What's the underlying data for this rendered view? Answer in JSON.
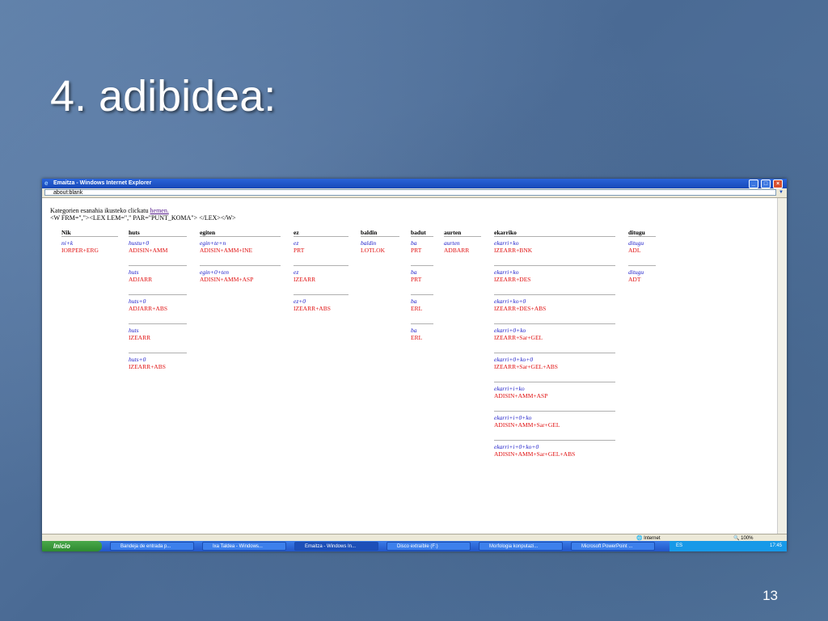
{
  "slide": {
    "title": "4. adibidea:",
    "page_number": "13"
  },
  "window": {
    "title": "Emaitza - Windows Internet Explorer",
    "address": "about:blank",
    "minimize": "_",
    "maximize": "□",
    "close": "×"
  },
  "content": {
    "intro_prefix": "Kategorien esanahia ikusteko clickatu ",
    "intro_link": "hemen.",
    "intro_line2": "<W FRM=\",\"><LEX LEM=\",\" PAR=\"PUNT_KOMA\"> </LEX></W>",
    "columns": [
      {
        "header": "Nik",
        "entries": [
          {
            "lemma": "ni+k",
            "cat": "IORPER+ERG"
          }
        ]
      },
      {
        "header": "huts",
        "entries": [
          {
            "lemma": "hustu+0",
            "cat": "ADISIN+AMM"
          },
          {
            "lemma": "huts",
            "cat": "ADJARR"
          },
          {
            "lemma": "huts+0",
            "cat": "ADJARR+ABS"
          },
          {
            "lemma": "huts",
            "cat": "IZEARR"
          },
          {
            "lemma": "huts+0",
            "cat": "IZEARR+ABS"
          }
        ]
      },
      {
        "header": "egiten",
        "entries": [
          {
            "lemma": "egin+te+n",
            "cat": "ADISIN+AMM+INE"
          },
          {
            "lemma": "egin+0+ten",
            "cat": "ADISIN+AMM+ASP"
          }
        ]
      },
      {
        "header": "ez",
        "entries": [
          {
            "lemma": "ez",
            "cat": "PRT"
          },
          {
            "lemma": "ez",
            "cat": "IZEARR"
          },
          {
            "lemma": "ez+0",
            "cat": "IZEARR+ABS"
          }
        ]
      },
      {
        "header": "baldin",
        "entries": [
          {
            "lemma": "baldin",
            "cat": "LOTLOK"
          }
        ]
      },
      {
        "header": "badut",
        "entries": [
          {
            "lemma": "ba",
            "cat": "PRT"
          },
          {
            "lemma": "ba",
            "cat": "PRT"
          },
          {
            "lemma": "ba",
            "cat": "ERL"
          },
          {
            "lemma": "ba",
            "cat": "ERL"
          }
        ]
      },
      {
        "header": "aurten",
        "entries": [
          {
            "lemma": "aurten",
            "cat": "ADBARR"
          }
        ]
      },
      {
        "header": "ekarriko",
        "entries": [
          {
            "lemma": "ekarri+ko",
            "cat": "IZEARR+BNK"
          },
          {
            "lemma": "ekarri+ko",
            "cat": "IZEARR+DES"
          },
          {
            "lemma": "ekarri+ko+0",
            "cat": "IZEARR+DES+ABS"
          },
          {
            "lemma": "ekarri+0+ko",
            "cat": "IZEARR+Sar+GEL"
          },
          {
            "lemma": "ekarri+0+ko+0",
            "cat": "IZEARR+Sar+GEL+ABS"
          },
          {
            "lemma": "ekarri+i+ko",
            "cat": "ADISIN+AMM+ASP"
          },
          {
            "lemma": "ekarri+i+0+ko",
            "cat": "ADISIN+AMM+Sar+GEL"
          },
          {
            "lemma": "ekarri+i+0+ko+0",
            "cat": "ADISIN+AMM+Sar+GEL+ABS"
          }
        ]
      },
      {
        "header": "ditugu",
        "entries": [
          {
            "lemma": "ditugu",
            "cat": "ADL"
          },
          {
            "lemma": "ditugu",
            "cat": "ADT"
          }
        ]
      }
    ]
  },
  "statusbar": {
    "zone": "Internet",
    "zoom": "100%"
  },
  "taskbar": {
    "start": "Inicio",
    "tasks": [
      {
        "label": "Bandeja de entrada p...",
        "active": false
      },
      {
        "label": "Ixa Taldea - Windows...",
        "active": false
      },
      {
        "label": "Emaitza - Windows In...",
        "active": true
      },
      {
        "label": "Disco extraíble (F:)",
        "active": false
      },
      {
        "label": "Morfologia konputazi...",
        "active": false
      },
      {
        "label": "Microsoft PowerPoint ...",
        "active": false
      }
    ],
    "lang": "ES",
    "clock": "17:45"
  },
  "colors": {
    "lemma": "#1a1ac8",
    "category": "#e01010",
    "title_bar": "#2a63d8"
  }
}
